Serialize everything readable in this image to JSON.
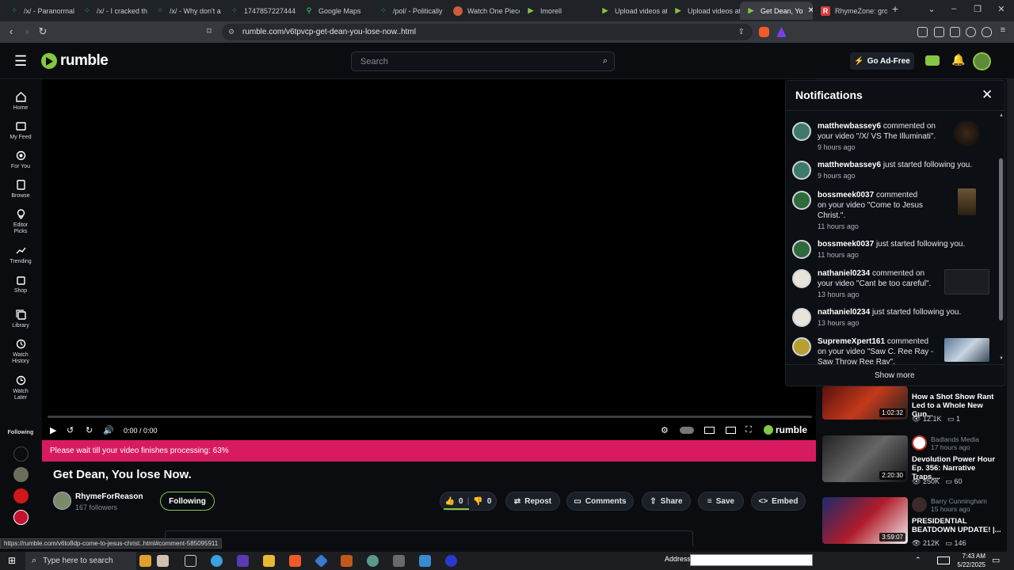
{
  "browser": {
    "tabs": [
      {
        "label": "/x/ - Paranormal",
        "icon": "4chan-icon",
        "color": "#1a8f3a"
      },
      {
        "label": "/x/ - I cracked th",
        "icon": "4chan-icon",
        "color": "#1a8f3a"
      },
      {
        "label": "/x/ - Why don't a",
        "icon": "4chan-icon",
        "color": "#1a8f3a"
      },
      {
        "label": "1747857227444",
        "icon": "4chan-icon",
        "color": "#1a8f3a"
      },
      {
        "label": "Google Maps",
        "icon": "maps-icon",
        "color": "#34a853"
      },
      {
        "label": "/pol/ - Politically",
        "icon": "4chan-icon",
        "color": "#1a8f3a"
      },
      {
        "label": "Watch One Piece",
        "icon": "site-icon",
        "color": "#d05c3b"
      },
      {
        "label": "Imorell",
        "icon": "rumble-icon",
        "color": "#85c742"
      },
      {
        "label": "Upload videos at",
        "icon": "rumble-icon",
        "color": "#85c742"
      },
      {
        "label": "Upload videos at",
        "icon": "rumble-icon",
        "color": "#85c742"
      },
      {
        "label": "Get Dean, Yo",
        "icon": "rumble-icon",
        "color": "#85c742"
      },
      {
        "label": "RhymeZone: gro",
        "icon": "rhymezone-icon",
        "color": "#d83a3a"
      }
    ],
    "url": "rumble.com/v6tpvcp-get-dean-you-lose-now..html",
    "status_url": "https://rumble.com/v6to8dp-come-to-jesus-christ..html#comment-585095911"
  },
  "site": {
    "logo": "rumble",
    "search_placeholder": "Search",
    "go_ad_free": "Go Ad-Free",
    "accent": "#85c742"
  },
  "sidebar": {
    "items": [
      {
        "label": "Home",
        "icon": "home-icon"
      },
      {
        "label": "My Feed",
        "icon": "feed-icon"
      },
      {
        "label": "For You",
        "icon": "target-icon"
      },
      {
        "label": "Browse",
        "icon": "browse-icon"
      },
      {
        "label": "Editor Picks",
        "icon": "trophy-icon"
      },
      {
        "label": "Trending",
        "icon": "trending-icon"
      },
      {
        "label": "Shop",
        "icon": "shop-icon"
      },
      {
        "label": "Library",
        "icon": "library-icon"
      },
      {
        "label": "Watch History",
        "icon": "history-icon"
      },
      {
        "label": "Watch Later",
        "icon": "clock-icon"
      }
    ],
    "following_label": "Following"
  },
  "player": {
    "time": "0:00 / 0:00",
    "processing": "Please wait till your video finishes processing: 63%",
    "processing_percent": 63,
    "brand": "rumble"
  },
  "video": {
    "title": "Get Dean, You lose Now.",
    "channel": "RhymeForReason",
    "followers": "167 followers",
    "follow_label": "Following",
    "likes": "0",
    "dislikes": "0",
    "repost": "Repost",
    "comments": "Comments",
    "share": "Share",
    "save": "Save",
    "embed": "Embed"
  },
  "notifications": {
    "title": "Notifications",
    "show_more": "Show more",
    "items": [
      {
        "user": "matthewbassey6",
        "text": "commented on your video \"/X/ VS The Illuminati\".",
        "time": "9 hours ago"
      },
      {
        "user": "matthewbassey6",
        "text": "just started following you.",
        "time": "9 hours ago"
      },
      {
        "user": "bossmeek0037",
        "text": "commented on your video \"Come to Jesus Christ.\".",
        "time": "11 hours ago"
      },
      {
        "user": "bossmeek0037",
        "text": "just started following you.",
        "time": "11 hours ago"
      },
      {
        "user": "nathaniel0234",
        "text": "commented on your video \"Cant be too careful\".",
        "time": "13 hours ago"
      },
      {
        "user": "nathaniel0234",
        "text": "just started following you.",
        "time": "13 hours ago"
      },
      {
        "user": "SupremeXpert161",
        "text": "commented on your video \"Saw C. Ree Ray - Saw Throw Ree Ray\".",
        "time": ""
      }
    ]
  },
  "related": [
    {
      "title": "How a Shot Show Rant Led to a Whole New Gun...",
      "duration": "1:02:32",
      "views": "12.1K",
      "comments": "1",
      "channel": "",
      "age": ""
    },
    {
      "title": "Devolution Power Hour Ep. 356: Narrative Traps,...",
      "duration": "2:20:30",
      "views": "250K",
      "comments": "60",
      "channel": "Badlands Media",
      "age": "17 hours ago"
    },
    {
      "title": "PRESIDENTIAL BEATDOWN UPDATE! |...",
      "duration": "3:59:07",
      "views": "212K",
      "comments": "146",
      "channel": "Barry Cunningham",
      "age": "15 hours ago"
    }
  ],
  "taskbar": {
    "search_placeholder": "Type here to search",
    "address_label": "Address",
    "time": "7:43 AM",
    "date": "5/22/2025"
  }
}
